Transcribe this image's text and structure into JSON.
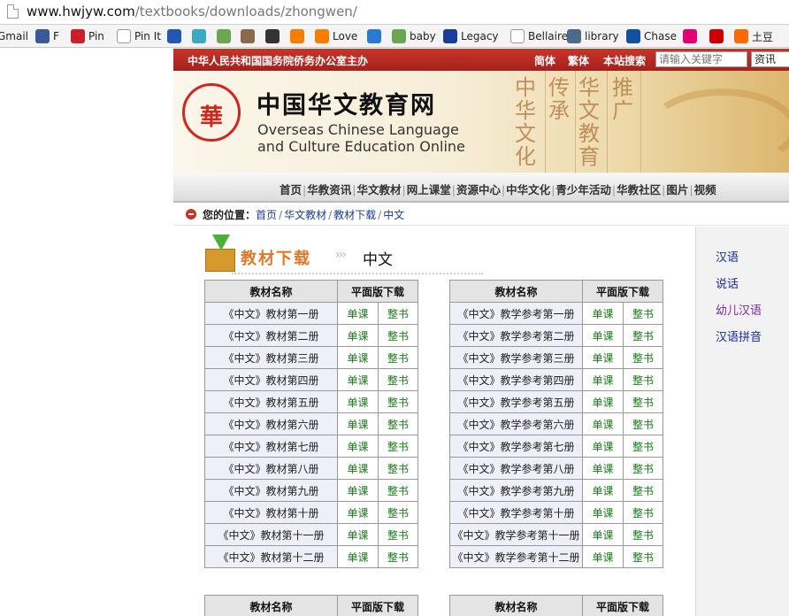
{
  "browser": {
    "url_host": "www.hwjyw.com",
    "url_path": "/textbooks/downloads/zhongwen/",
    "bookmarks": [
      {
        "label": "Gmail",
        "icon": "gmail-icon",
        "color": "#d44"
      },
      {
        "label": "F",
        "icon": "facebook-icon",
        "color": "#3b5998"
      },
      {
        "label": "Pin",
        "icon": "pinterest-icon",
        "color": "#cb2027"
      },
      {
        "label": "Pin It",
        "icon": "page-icon",
        "color": "#ffffff"
      },
      {
        "label": "",
        "icon": "paw-icon",
        "color": "#2355b5"
      },
      {
        "label": "",
        "icon": "app-icon",
        "color": "#3aa9c8"
      },
      {
        "label": "",
        "icon": "photo-icon",
        "color": "#6aa84f"
      },
      {
        "label": "",
        "icon": "portrait-icon",
        "color": "#8a6a4a"
      },
      {
        "label": "",
        "icon": "amazon-icon",
        "color": "#333333"
      },
      {
        "label": "",
        "icon": "blogger-icon",
        "color": "#f57d00"
      },
      {
        "label": "Love",
        "icon": "blogger-icon",
        "color": "#f57d00"
      },
      {
        "label": "",
        "icon": "ie-icon",
        "color": "#2a7ad1"
      },
      {
        "label": "baby",
        "icon": "flower-icon",
        "color": "#6aa84f"
      },
      {
        "label": "Legacy",
        "icon": "legacy-icon",
        "color": "#1a3d99"
      },
      {
        "label": "Bellaire",
        "icon": "page-icon",
        "color": "#ffffff"
      },
      {
        "label": "library",
        "icon": "globe-icon",
        "color": "#4a6b8a"
      },
      {
        "label": "Chase",
        "icon": "chase-icon",
        "color": "#11509e"
      },
      {
        "label": "",
        "icon": "tmobile-icon",
        "color": "#e20074"
      },
      {
        "label": "",
        "icon": "target-icon",
        "color": "#cc0000"
      },
      {
        "label": "土豆",
        "icon": "tudou-icon",
        "color": "#ff6a00"
      }
    ]
  },
  "site": {
    "host_text": "中华人民共和国国务院侨务办公室主办",
    "lang_links": [
      "简体",
      "繁体"
    ],
    "search_label": "本站搜索",
    "search_placeholder": "请输入关键字",
    "search_category": "资讯",
    "logo_glyph": "華",
    "cn_title": "中国华文教育网",
    "en_title_line1": "Overseas Chinese Language",
    "en_title_line2": "and Culture Education Online",
    "calligraphy": [
      "中华文化",
      "传承",
      "华文教育",
      "推广"
    ],
    "nav": [
      "首页",
      "华教资讯",
      "华文教材",
      "网上课堂",
      "资源中心",
      "中华文化",
      "青少年活动",
      "华教社区",
      "图片",
      "视频"
    ],
    "breadcrumb": {
      "label": "您的位置：",
      "items": [
        "首页",
        "华文教材",
        "教材下载",
        "中文"
      ]
    },
    "section": {
      "title": "教材下载",
      "subtitle": "中文"
    },
    "table_headers": {
      "name": "教材名称",
      "download": "平面版下载"
    },
    "link_single": "单课",
    "link_whole": "整书",
    "table_left": [
      "《中文》教材第一册",
      "《中文》教材第二册",
      "《中文》教材第三册",
      "《中文》教材第四册",
      "《中文》教材第五册",
      "《中文》教材第六册",
      "《中文》教材第七册",
      "《中文》教材第八册",
      "《中文》教材第九册",
      "《中文》教材第十册",
      "《中文》教材第十一册",
      "《中文》教材第十二册"
    ],
    "table_right": [
      "《中文》教学参考第一册",
      "《中文》教学参考第二册",
      "《中文》教学参考第三册",
      "《中文》教学参考第四册",
      "《中文》教学参考第五册",
      "《中文》教学参考第六册",
      "《中文》教学参考第七册",
      "《中文》教学参考第八册",
      "《中文》教学参考第九册",
      "《中文》教学参考第十册",
      "《中文》教学参考第十一册",
      "《中文》教学参考第十二册"
    ],
    "sidebar": [
      {
        "label": "汉语",
        "visited": false
      },
      {
        "label": "说话",
        "visited": false
      },
      {
        "label": "幼儿汉语",
        "visited": true
      },
      {
        "label": "汉语拼音",
        "visited": false
      }
    ]
  }
}
